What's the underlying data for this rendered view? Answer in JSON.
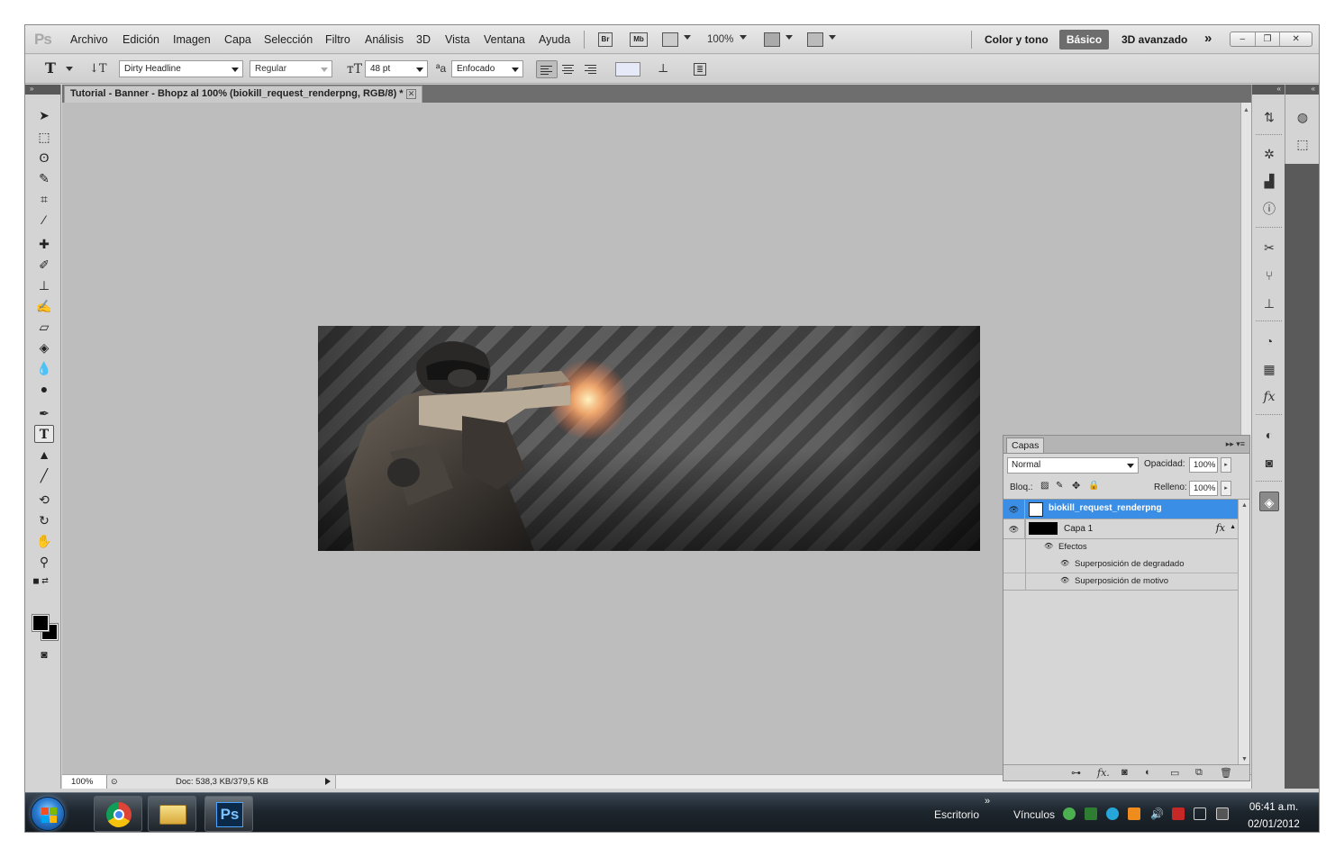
{
  "app": {
    "logo": "Ps",
    "menus": [
      "Archivo",
      "Edición",
      "Imagen",
      "Capa",
      "Selección",
      "Filtro",
      "Análisis",
      "3D",
      "Vista",
      "Ventana",
      "Ayuda"
    ],
    "bridge_label": "Br",
    "minibridge_label": "Mb",
    "zoom": "100%",
    "workspaces": [
      "Color y tono",
      "Básico",
      "3D avanzado"
    ],
    "active_workspace": "Básico",
    "more_workspaces": "»",
    "window_controls": [
      "–",
      "❐",
      "✕"
    ]
  },
  "options": {
    "font_family": "Dirty Headline",
    "font_style": "Regular",
    "font_size": "48 pt",
    "antialias": "Enfocado",
    "text_color": "#e6e9f7"
  },
  "document": {
    "tab_title": "Tutorial - Banner - Bhopz al 100% (biokill_request_renderpng, RGB/8) *",
    "status_zoom": "100%",
    "doc_info": "Doc: 538,3 KB/379,5 KB"
  },
  "layers_panel": {
    "tab": "Capas",
    "blend_mode": "Normal",
    "opacity_label": "Opacidad:",
    "opacity": "100%",
    "lock_label": "Bloq.:",
    "fill_label": "Relleno:",
    "fill": "100%",
    "layers": [
      {
        "name": "biokill_request_renderpng",
        "selected": true
      },
      {
        "name": "Capa 1",
        "selected": false,
        "fx": "fx"
      }
    ],
    "effects_label": "Efectos",
    "effects": [
      "Superposición de degradado",
      "Superposición de motivo"
    ]
  },
  "taskbar": {
    "desktop_label": "Escritorio",
    "links_label": "Vínculos",
    "time": "06:41 a.m.",
    "date": "02/01/2012",
    "ps_label": "Ps"
  },
  "colors": {
    "selected_layer": "#3a8ee6",
    "canvas_bg": "#bdbdbd",
    "foreground": "#000000",
    "background": "#000000"
  }
}
